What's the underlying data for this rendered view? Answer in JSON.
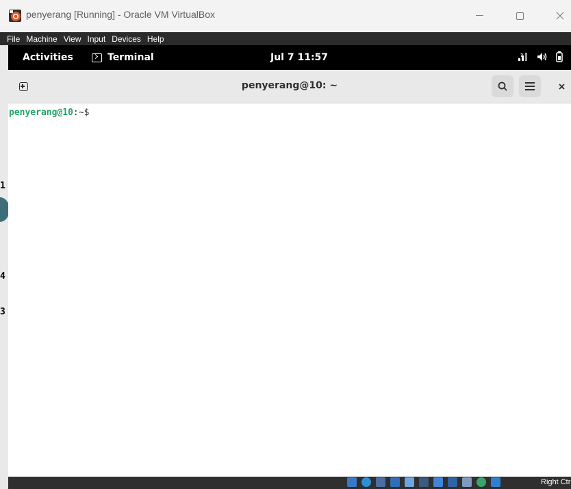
{
  "window": {
    "title": "penyerang [Running] - Oracle VM VirtualBox",
    "icon": "virtualbox-icon",
    "controls": [
      "minimize",
      "maximize",
      "close"
    ]
  },
  "vbox_menu": [
    "File",
    "Machine",
    "View",
    "Input",
    "Devices",
    "Help"
  ],
  "gnome_topbar": {
    "activities": "Activities",
    "app_name": "Terminal",
    "clock": "Jul 7  11:57",
    "tray_icons": [
      "network-icon",
      "volume-icon",
      "battery-icon"
    ]
  },
  "terminal": {
    "title": "penyerang@10: ~",
    "prompt_user": "penyerang@10",
    "prompt_suffix": ":~$"
  },
  "host_sliver_chars": [
    "1",
    "4",
    "3"
  ],
  "statusbar": {
    "host_key": "Right Ctrl",
    "icons": [
      "hard-disk-icon",
      "optical-drive-icon",
      "audio-icon",
      "network-icon",
      "usb-icon",
      "shared-folders-icon",
      "display-icon",
      "recording-icon",
      "cpu-icon",
      "mouse-integration-icon",
      "keyboard-icon"
    ]
  },
  "colors": {
    "prompt_green": "#26a269",
    "topbar_bg": "#000000",
    "header_bg": "#e9e9e9"
  }
}
